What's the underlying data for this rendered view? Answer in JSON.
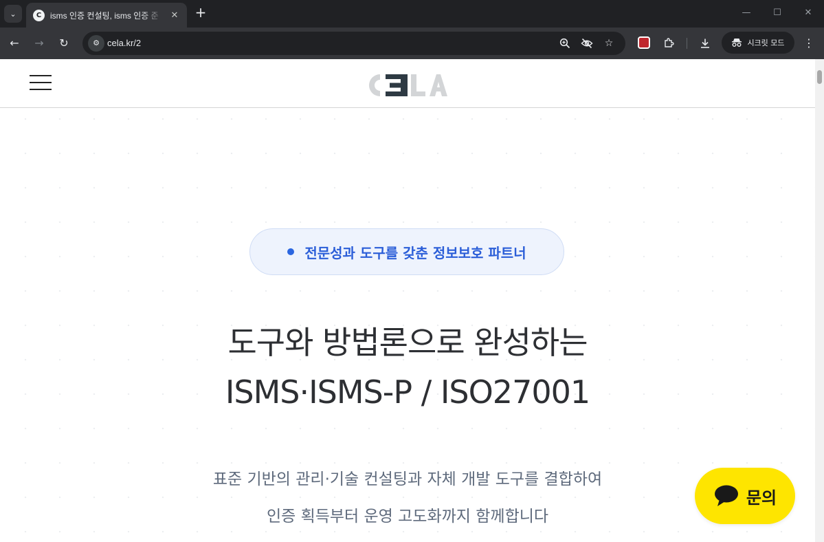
{
  "browser": {
    "tab_title": "isms 인증 컨설팅, isms 인증 준",
    "url": "cela.kr/2",
    "incognito_label": "시크릿 모드",
    "favicon_letter": "C"
  },
  "site": {
    "logo_text": "CELA",
    "logo_colors": {
      "light": "#d3d5d7",
      "dark": "#2e3a43"
    }
  },
  "hero": {
    "badge": "전문성과 도구를 갖춘 정보보호 파트너",
    "headline_line1": "도구와 방법론으로 완성하는",
    "headline_line2": "ISMS·ISMS-P / ISO27001",
    "subtext_line1": "표준 기반의 관리·기술 컨설팅과 자체 개발 도구를 결합하여",
    "subtext_line2": "인증 획득부터 운영 고도화까지 함께합니다"
  },
  "chat": {
    "label": "문의",
    "color": "#fee500"
  },
  "colors": {
    "accent": "#2b5ed8",
    "headline": "#2d2f33",
    "subtext": "#5e6a7c"
  }
}
